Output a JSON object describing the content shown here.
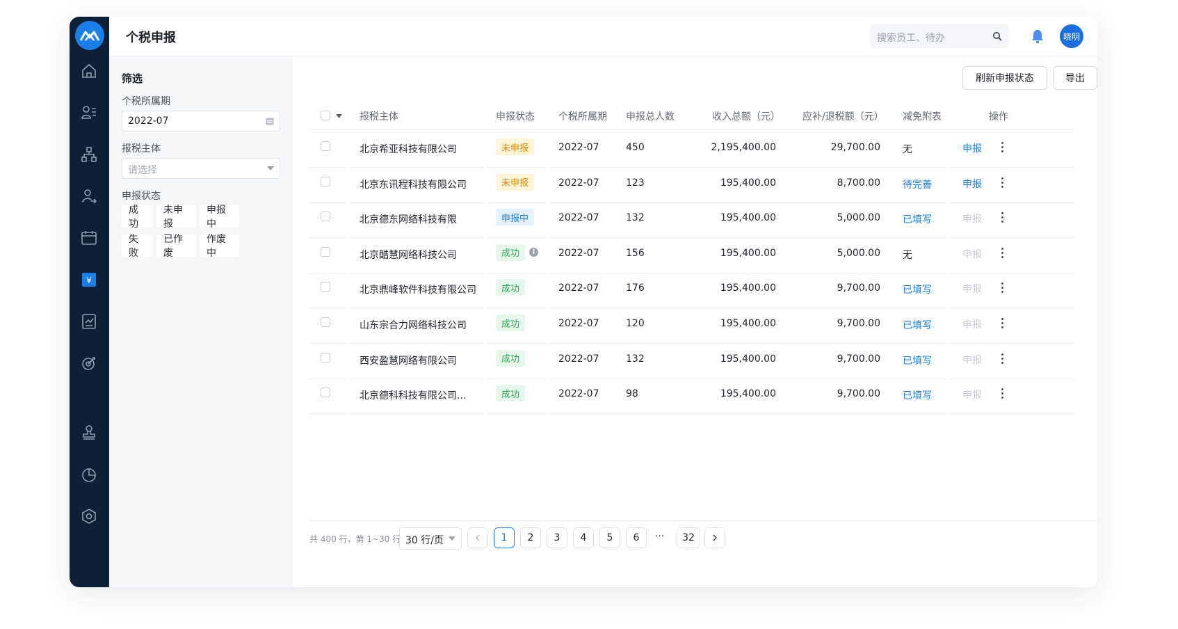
{
  "app": {
    "title": "个税申报",
    "brand_color": "#1a7fe8"
  },
  "search": {
    "placeholder": "搜索员工、待办"
  },
  "user": {
    "avatar_label": "晓明"
  },
  "sidebar": {
    "icons": [
      "home-icon",
      "employees-icon",
      "org-icon",
      "person-icon",
      "calendar-icon",
      "tax-icon",
      "report-icon",
      "target-icon",
      "stamp-icon",
      "chart-icon",
      "settings-icon"
    ],
    "active": "tax-icon"
  },
  "filter": {
    "heading": "筛选",
    "period_label": "个税所属期",
    "period_value": "2022-07",
    "entity_label": "报税主体",
    "entity_placeholder": "请选择",
    "status_label": "申报状态",
    "status_chips": [
      "成功",
      "未申报",
      "申报中",
      "失败",
      "已作废",
      "作废中"
    ]
  },
  "toolbar": {
    "refresh_label": "刷新申报状态",
    "export_label": "导出"
  },
  "table": {
    "headers": {
      "entity": "报税主体",
      "status": "申报状态",
      "period": "个税所属期",
      "count": "申报总人数",
      "income": "收入总额（元）",
      "tax": "应补/退税额（元）",
      "attach": "减免附表",
      "action": "操作"
    },
    "rows": [
      {
        "entity": "北京希亚科技有限公司",
        "status": "未申报",
        "period": "2022-07",
        "count": "450",
        "income": "2,195,400.00",
        "tax": "29,700.00",
        "attach": "无",
        "action": "申报"
      },
      {
        "entity": "北京东讯程科技有限公司",
        "status": "未申报",
        "period": "2022-07",
        "count": "123",
        "income": "195,400.00",
        "tax": "8,700.00",
        "attach": "待完善",
        "action": "申报"
      },
      {
        "entity": "北京德东网络科技有限",
        "status": "申报中",
        "period": "2022-07",
        "count": "132",
        "income": "195,400.00",
        "tax": "5,000.00",
        "attach": "已填写",
        "action": "申报"
      },
      {
        "entity": "北京酷慧网络科技公司",
        "status": "成功",
        "period": "2022-07",
        "count": "156",
        "income": "195,400.00",
        "tax": "5,000.00",
        "attach": "无",
        "action": "申报"
      },
      {
        "entity": "北京鼎峰软件科技有限公司",
        "status": "成功",
        "period": "2022-07",
        "count": "176",
        "income": "195,400.00",
        "tax": "9,700.00",
        "attach": "已填写",
        "action": "申报"
      },
      {
        "entity": "山东宗合力网络科技公司",
        "status": "成功",
        "period": "2022-07",
        "count": "120",
        "income": "195,400.00",
        "tax": "9,700.00",
        "attach": "已填写",
        "action": "申报"
      },
      {
        "entity": "西安盈慧网络有限公司",
        "status": "成功",
        "period": "2022-07",
        "count": "132",
        "income": "195,400.00",
        "tax": "9,700.00",
        "attach": "已填写",
        "action": "申报"
      },
      {
        "entity": "北京德科科技有限公司...",
        "status": "成功",
        "period": "2022-07",
        "count": "98",
        "income": "195,400.00",
        "tax": "9,700.00",
        "attach": "已填写",
        "action": "申报"
      }
    ]
  },
  "pagination": {
    "total_text": "共 400 行，第 1~30 行",
    "page_size": "30 行/页",
    "pages": [
      "1",
      "2",
      "3",
      "4",
      "5",
      "6"
    ],
    "ellipsis": "···",
    "last_page": "32",
    "current": "1"
  }
}
